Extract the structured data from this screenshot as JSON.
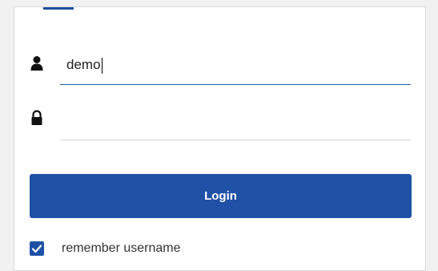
{
  "login_form": {
    "username": {
      "value": "demo",
      "icon": "user-icon"
    },
    "password": {
      "value": "",
      "icon": "lock-icon"
    },
    "login_button": {
      "label": "Login"
    },
    "remember": {
      "label": "remember username",
      "checked": true,
      "icon": "checkmark-icon"
    }
  },
  "colors": {
    "accent": "#1f52a6",
    "focus_underline": "#1f5fa8",
    "page_background": "#f1f1f1",
    "card_background": "#ffffff"
  }
}
